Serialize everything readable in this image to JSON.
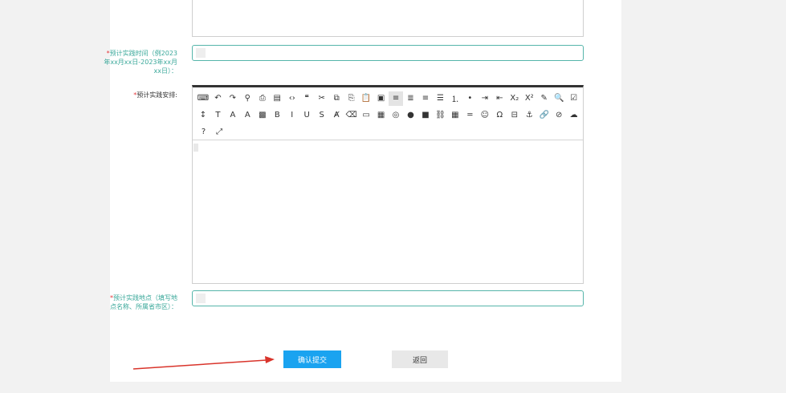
{
  "form": {
    "time_label": "预计实践时间（例2023年xx月xx日-2023年xx月xx日）：",
    "time_label_lines": [
      "预计实践时间（例2023",
      "年xx月xx日-2023年xx月",
      "xx日）："
    ],
    "arrangement_label": "预计实践安排:",
    "location_label_lines": [
      "预计实践地点（填写地",
      "点名称、所属省市区）："
    ],
    "required_mark": "*",
    "time_value": "",
    "location_value": "",
    "editor_content": ""
  },
  "toolbar": {
    "row1": [
      "source-code",
      "undo",
      "redo",
      "preview-search",
      "print",
      "template",
      "code",
      "quote",
      "cut",
      "copy",
      "copy-format",
      "paste",
      "paste-text",
      "align-left",
      "align-center",
      "align-right",
      "align-justify",
      "ordered-list",
      "unordered-list",
      "indent",
      "outdent",
      "subscript",
      "superscript",
      "format-painter",
      "find-replace",
      "select-all"
    ],
    "row2": [
      "line-height",
      "font-family",
      "font-size",
      "font-color",
      "bg-color",
      "bold",
      "italic",
      "underline",
      "strikethrough",
      "remove-format",
      "eraser",
      "image",
      "multi-image",
      "media",
      "emoji-face",
      "video",
      "link-image",
      "table",
      "horizontal-rule",
      "emoticon",
      "special-char",
      "page-break",
      "anchor",
      "link",
      "unlink",
      "upload"
    ],
    "row3": [
      "help",
      "fullscreen"
    ]
  },
  "buttons": {
    "submit": "确认提交",
    "back": "返回"
  },
  "colors": {
    "accent": "#1aa3f0",
    "label": "#3aa89a",
    "required": "#e4393c",
    "arrow": "#d9342b"
  }
}
